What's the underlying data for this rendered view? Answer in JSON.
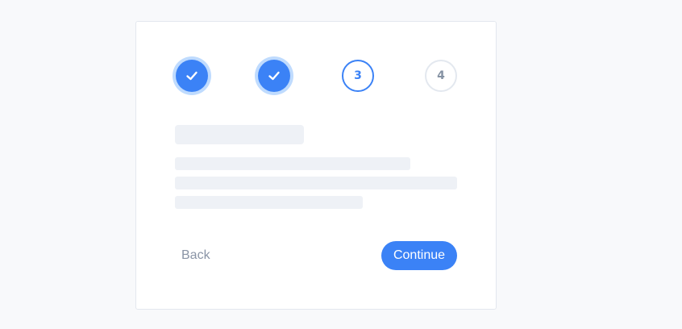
{
  "stepper": {
    "steps": [
      {
        "label": "",
        "state": "complete",
        "icon": "check-icon"
      },
      {
        "label": "",
        "state": "complete",
        "icon": "check-icon"
      },
      {
        "label": "3",
        "state": "current"
      },
      {
        "label": "4",
        "state": "upcoming"
      }
    ]
  },
  "content": {
    "loading": true
  },
  "actions": {
    "back_label": "Back",
    "continue_label": "Continue"
  },
  "colors": {
    "accent": "#3b82f6",
    "accent_ring": "#bfdbfe",
    "background": "#f8f9fb",
    "card": "#ffffff",
    "skeleton": "#eef1f6",
    "muted_text": "#8a94a6"
  }
}
